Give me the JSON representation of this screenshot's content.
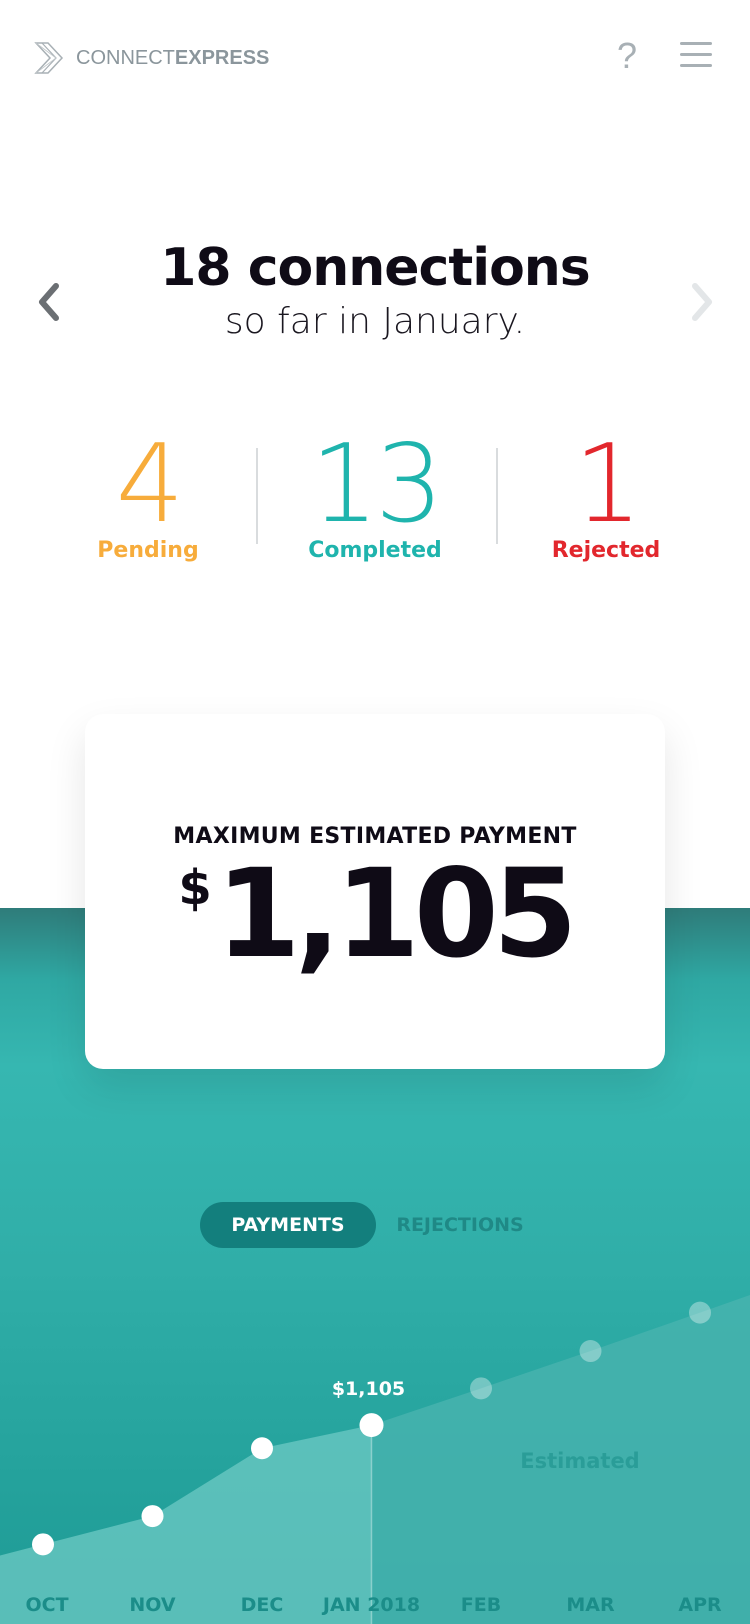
{
  "header": {
    "logo_light": "CONNECT",
    "logo_bold": "EXPRESS",
    "help_glyph": "?",
    "icons": [
      "logo-chevron-icon",
      "help-icon",
      "menu-icon"
    ]
  },
  "headline": {
    "title": "18 connections",
    "subtitle": "so far in January."
  },
  "stats": [
    {
      "value": "4",
      "label": "Pending",
      "color": "#f7ac3b"
    },
    {
      "value": "13",
      "label": "Completed",
      "color": "#1fb4ad"
    },
    {
      "value": "1",
      "label": "Rejected",
      "color": "#e2272d"
    }
  ],
  "card": {
    "label": "MAXIMUM ESTIMATED PAYMENT",
    "currency": "$",
    "amount": "1,105"
  },
  "toggle": {
    "active": "PAYMENTS",
    "inactive": "REJECTIONS"
  },
  "chart_data": {
    "type": "area",
    "categories": [
      "OCT",
      "NOV",
      "DEC",
      "JAN 2018",
      "FEB",
      "MAR",
      "APR"
    ],
    "values": [
      50,
      300,
      900,
      1105,
      1430,
      1760,
      2100
    ],
    "estimated_from_index": 4,
    "estimated_label": "Estimated",
    "highlight_index": 3,
    "highlight_label": "$1,105",
    "ylim": [
      0,
      2300
    ],
    "grid": false,
    "colors": {
      "actual_fill": "#6ec9c4",
      "estimated_fill": "#46b3ae",
      "point": "#ffffff",
      "axis_label": "#1b8d89"
    }
  },
  "colors": {
    "brand_teal": "#36b7b1",
    "dark_teal": "#137f7d",
    "text_dark": "#0f0b16",
    "logo_grey": "#8b969c"
  }
}
